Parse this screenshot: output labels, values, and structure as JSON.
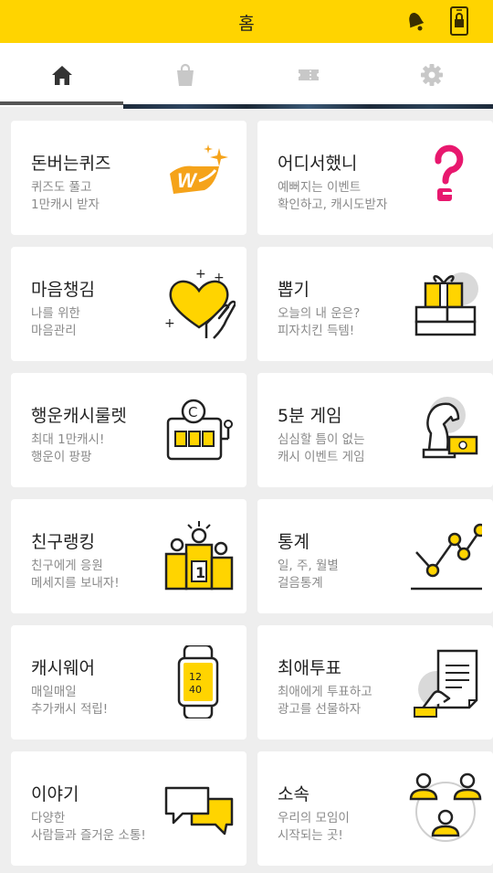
{
  "header": {
    "title": "홈"
  },
  "tabs": [
    {
      "icon": "home-icon"
    },
    {
      "icon": "shopping-bag-icon"
    },
    {
      "icon": "ticket-icon"
    },
    {
      "icon": "gear-icon"
    }
  ],
  "colors": {
    "accent": "#ffd400",
    "dark": "#222222",
    "muted": "#8a8a8a"
  },
  "cards": [
    {
      "title": "돈버는퀴즈",
      "line1": "퀴즈도 풀고",
      "line2": "1만캐시 받자",
      "icon": "won-coin-icon"
    },
    {
      "title": "어디서했니",
      "line1": "예뻐지는 이벤트",
      "line2": "확인하고, 캐시도받자",
      "icon": "question-mark-icon"
    },
    {
      "title": "마음챙김",
      "line1": "나를 위한",
      "line2": "마음관리",
      "icon": "heart-hand-icon"
    },
    {
      "title": "뽑기",
      "line1": "오늘의 내 운은?",
      "line2": "피자치킨 득템!",
      "icon": "gift-box-icon"
    },
    {
      "title": "행운캐시룰렛",
      "line1": "최대 1만캐시!",
      "line2": "행운이 팡팡",
      "icon": "slot-machine-icon"
    },
    {
      "title": "5분 게임",
      "line1": "심심할 틈이 없는",
      "line2": "캐시 이벤트 게임",
      "icon": "chess-knight-icon"
    },
    {
      "title": "친구랭킹",
      "line1": "친구에게 응원",
      "line2": "메세지를 보내자!",
      "icon": "podium-icon"
    },
    {
      "title": "통계",
      "line1": "일, 주, 월별",
      "line2": "걸음통계",
      "icon": "line-chart-icon"
    },
    {
      "title": "캐시웨어",
      "line1": "매일매일",
      "line2": "추가캐시 적립!",
      "icon": "smart-watch-icon",
      "watch_hour": "12",
      "watch_min": "40"
    },
    {
      "title": "최애투표",
      "line1": "최애에게 투표하고",
      "line2": "광고를 선물하자",
      "icon": "vote-paper-icon"
    },
    {
      "title": "이야기",
      "line1": "다양한",
      "line2": "사람들과 즐거운 소통!",
      "icon": "chat-bubbles-icon"
    },
    {
      "title": "소속",
      "line1": "우리의 모임이",
      "line2": "시작되는 곳!",
      "icon": "group-people-icon"
    }
  ]
}
